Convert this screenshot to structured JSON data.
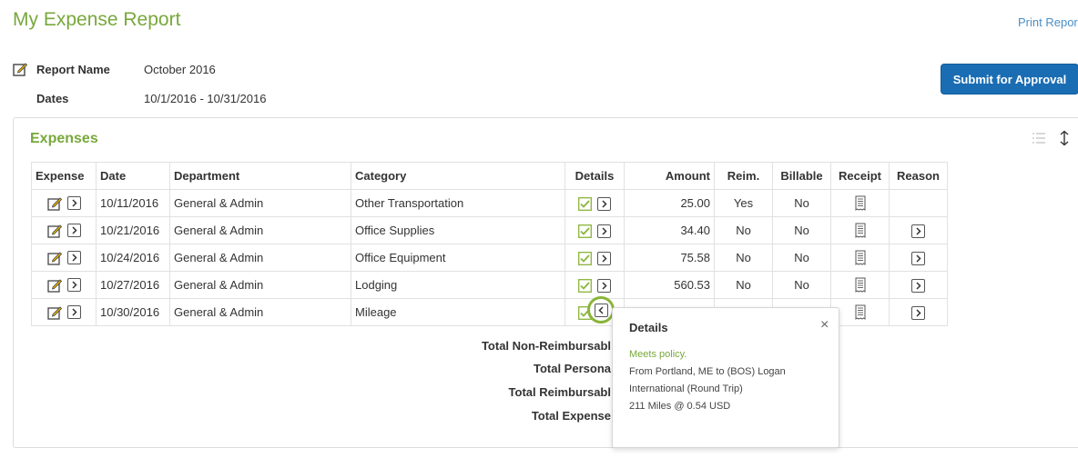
{
  "header": {
    "title": "My Expense Report",
    "print_link": "Print Report",
    "report_name_label": "Report Name",
    "report_name_value": "October 2016",
    "dates_label": "Dates",
    "dates_value": "10/1/2016 - 10/31/2016",
    "submit_label": "Submit for Approval"
  },
  "expenses": {
    "title": "Expenses",
    "columns": [
      "Expense",
      "Date",
      "Department",
      "Category",
      "Details",
      "Amount",
      "Reim.",
      "Billable",
      "Receipt",
      "Reason"
    ],
    "rows": [
      {
        "date": "10/11/2016",
        "department": "General & Admin",
        "category": "Other Transportation",
        "amount": "25.00",
        "reim": "Yes",
        "billable": "No",
        "has_reason": false
      },
      {
        "date": "10/21/2016",
        "department": "General & Admin",
        "category": "Office Supplies",
        "amount": "34.40",
        "reim": "No",
        "billable": "No",
        "has_reason": true
      },
      {
        "date": "10/24/2016",
        "department": "General & Admin",
        "category": "Office Equipment",
        "amount": "75.58",
        "reim": "No",
        "billable": "No",
        "has_reason": true
      },
      {
        "date": "10/27/2016",
        "department": "General & Admin",
        "category": "Lodging",
        "amount": "560.53",
        "reim": "No",
        "billable": "No",
        "has_reason": true
      },
      {
        "date": "10/30/2016",
        "department": "General & Admin",
        "category": "Mileage",
        "amount": "",
        "reim": "",
        "billable": "",
        "has_reason": true
      }
    ]
  },
  "totals": {
    "non_reimbursable": "Total Non-Reimbursabl",
    "personal": "Total Persona",
    "reimbursable": "Total Reimbursabl",
    "expenses": "Total Expense"
  },
  "details_popover": {
    "title": "Details",
    "close": "×",
    "policy": "Meets policy.",
    "line1": "From Portland, ME to (BOS) Logan",
    "line2": "International (Round Trip)",
    "line3": "211 Miles @ 0.54 USD"
  },
  "colors": {
    "accent_green": "#78a83c",
    "primary_blue": "#1a6db3",
    "link_blue": "#4a8ec6"
  }
}
